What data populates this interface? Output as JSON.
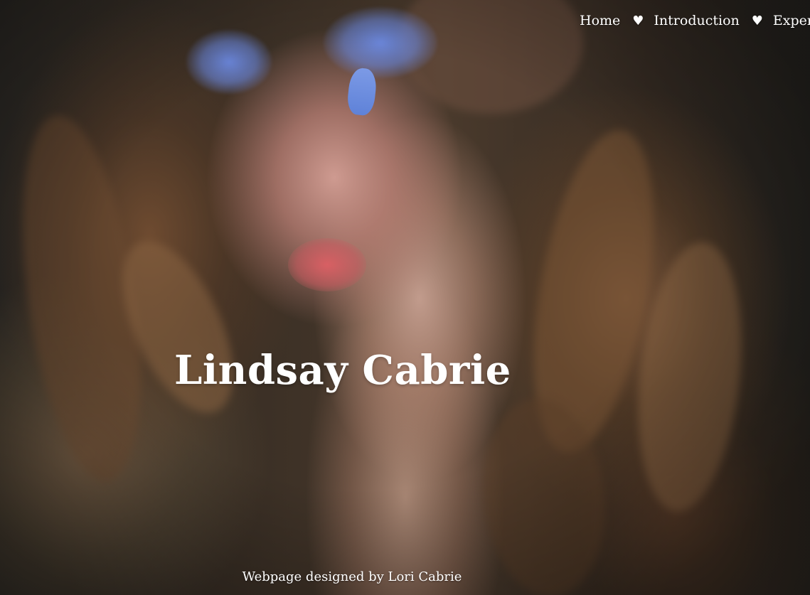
{
  "nav": {
    "items": [
      {
        "label": "Home"
      },
      {
        "label": "Introduction"
      },
      {
        "label": "Experie"
      }
    ],
    "separator": "♥"
  },
  "hero": {
    "title": "Lindsay Cabrie"
  },
  "footer": {
    "credit": "Webpage designed by Lori Cabrie"
  },
  "colors": {
    "text": "#ffffff",
    "eyeshadow": "#6f8ce6",
    "nail_polish": "#6b8cdc"
  }
}
